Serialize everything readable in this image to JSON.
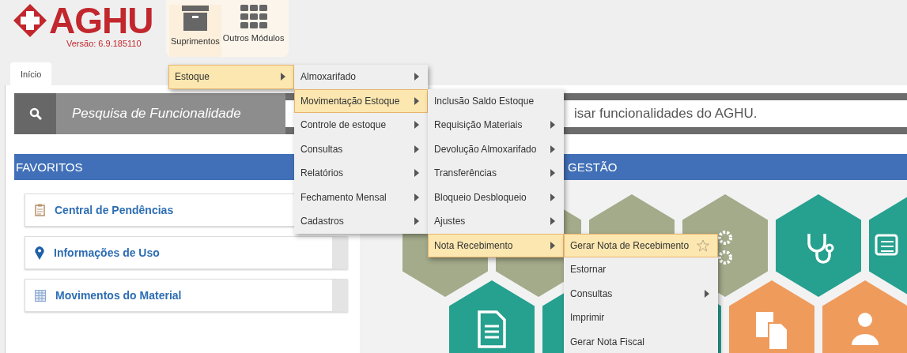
{
  "header": {
    "logo": "AGHU",
    "version": "Versão: 6.9.185110",
    "modules": [
      {
        "label": "Suprimentos",
        "kind": "box",
        "selected": true
      },
      {
        "label": "Outros Módulos",
        "kind": "grid",
        "selected": false
      }
    ]
  },
  "tabs": [
    {
      "label": "Início",
      "selected": true
    }
  ],
  "search": {
    "label": "Pesquisa de Funcionalidade",
    "placeholder": "isar funcionalidades do AGHU."
  },
  "favorites": {
    "title": "FAVORITOS",
    "items": [
      {
        "label": "Central de Pendências",
        "kind": "checklist"
      },
      {
        "label": "Informações de Uso",
        "kind": "pin"
      },
      {
        "label": "Movimentos do Material",
        "kind": "table"
      }
    ]
  },
  "management": {
    "title": "GESTÃO"
  },
  "menu": {
    "items": [
      {
        "label": "Estoque",
        "submenu": true,
        "selected": true,
        "children": [
          {
            "label": "Almoxarifado",
            "submenu": true,
            "selected": false
          },
          {
            "label": "Movimentação Estoque",
            "submenu": true,
            "selected": true,
            "children": [
              {
                "label": "Inclusão Saldo Estoque",
                "submenu": false,
                "selected": false
              },
              {
                "label": "Requisição Materiais",
                "submenu": true,
                "selected": false
              },
              {
                "label": "Devolução Almoxarifado",
                "submenu": true,
                "selected": false
              },
              {
                "label": "Transferências",
                "submenu": true,
                "selected": false
              },
              {
                "label": "Bloqueio Desbloqueio",
                "submenu": true,
                "selected": false
              },
              {
                "label": "Ajustes",
                "submenu": true,
                "selected": false
              },
              {
                "label": "Nota Recebimento",
                "submenu": true,
                "selected": true,
                "children": [
                  {
                    "label": "Gerar Nota de Recebimento",
                    "submenu": false,
                    "selected": true,
                    "favorite": false
                  },
                  {
                    "label": "Estornar",
                    "submenu": false,
                    "selected": false
                  },
                  {
                    "label": "Consultas",
                    "submenu": true,
                    "selected": false
                  },
                  {
                    "label": "Imprimir",
                    "submenu": false,
                    "selected": false
                  },
                  {
                    "label": "Gerar Nota Fiscal",
                    "submenu": false,
                    "selected": false
                  }
                ]
              }
            ]
          },
          {
            "label": "Controle de estoque",
            "submenu": true,
            "selected": false
          },
          {
            "label": "Consultas",
            "submenu": true,
            "selected": false
          },
          {
            "label": "Relatórios",
            "submenu": true,
            "selected": false
          },
          {
            "label": "Fechamento Mensal",
            "submenu": true,
            "selected": false
          },
          {
            "label": "Cadastros",
            "submenu": true,
            "selected": false
          }
        ]
      }
    ]
  }
}
